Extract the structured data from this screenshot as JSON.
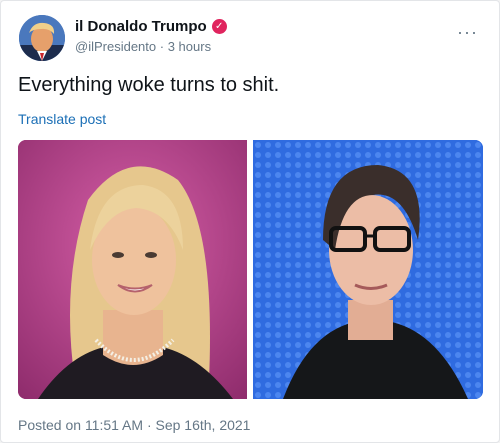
{
  "tweet": {
    "display_name": "il Donaldo Trumpo",
    "verified_icon": "verified-badge-icon",
    "handle": "@ilPresidento",
    "separator": "·",
    "time_ago": "3 hours",
    "more_label": "···",
    "text": "Everything woke turns to shit.",
    "translate_label": "Translate post",
    "posted_on": "Posted on 11:51 AM · Sep 16th, 2021"
  },
  "colors": {
    "link": "#1b6fb6",
    "verified_badge": "#e0245e",
    "secondary_text": "#657786"
  },
  "media": {
    "left_photo": "yearbook-portrait-blonde-woman",
    "right_photo": "woman-with-glasses-dark-shirt"
  }
}
